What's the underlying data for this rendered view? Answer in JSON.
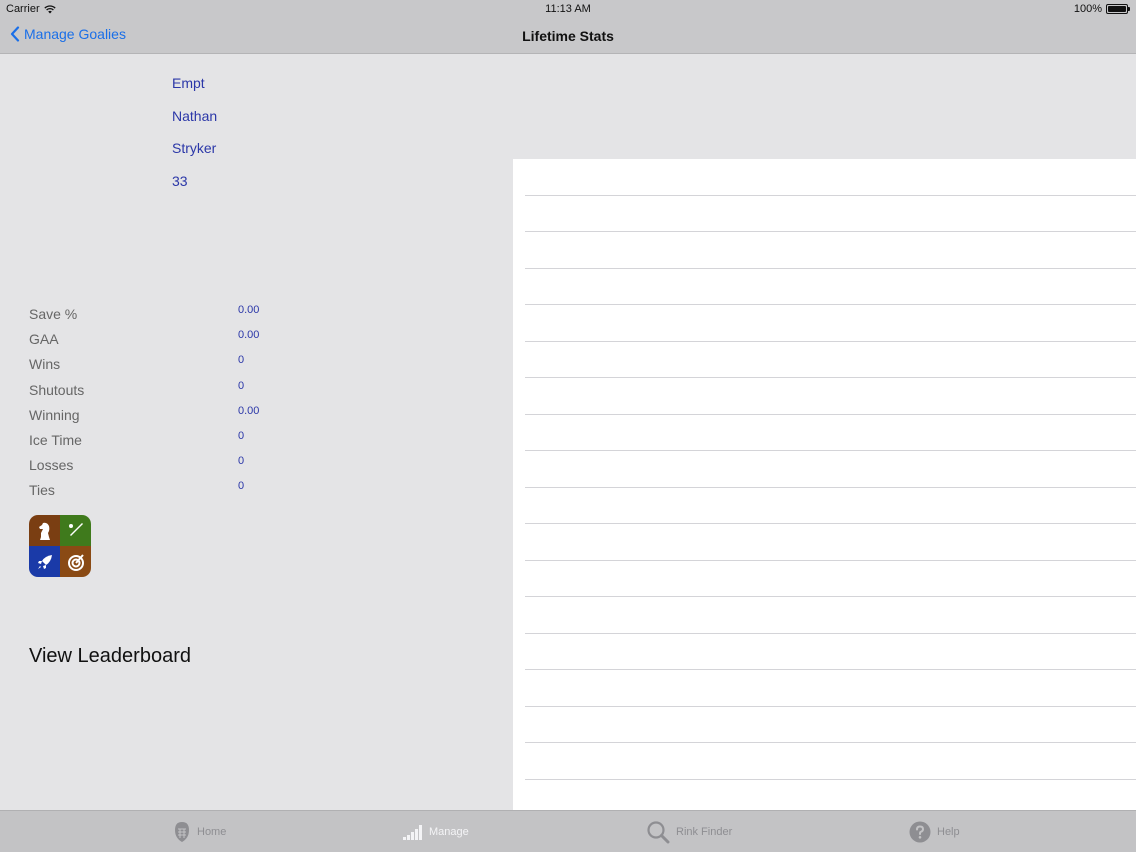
{
  "status_bar": {
    "carrier": "Carrier",
    "time": "11:13 AM",
    "battery": "100%"
  },
  "nav": {
    "back_label": "Manage Goalies",
    "title": "Lifetime Stats"
  },
  "goalie": {
    "line1": "Empt",
    "first_name": "Nathan",
    "last_name": "Stryker",
    "number": "33"
  },
  "stats": [
    {
      "label": "Save %",
      "value": "0.00"
    },
    {
      "label": "GAA",
      "value": "0.00"
    },
    {
      "label": "Wins",
      "value": "0"
    },
    {
      "label": "Shutouts",
      "value": "0"
    },
    {
      "label": "Winning",
      "value": "0.00"
    },
    {
      "label": "Ice Time",
      "value": "0"
    },
    {
      "label": "Losses",
      "value": "0"
    },
    {
      "label": "Ties",
      "value": "0"
    }
  ],
  "leaderboard_label": "View Leaderboard",
  "tabs": [
    {
      "label": "Home",
      "icon": "goalie-mask-icon"
    },
    {
      "label": "Manage",
      "icon": "signal-bars-icon"
    },
    {
      "label": "Rink Finder",
      "icon": "magnifier-icon"
    },
    {
      "label": "Help",
      "icon": "help-icon"
    }
  ],
  "colors": {
    "accent": "#1a6fe8",
    "value_text": "#2b37a8",
    "background": "#e4e4e6",
    "bar": "#c8c8ca"
  }
}
